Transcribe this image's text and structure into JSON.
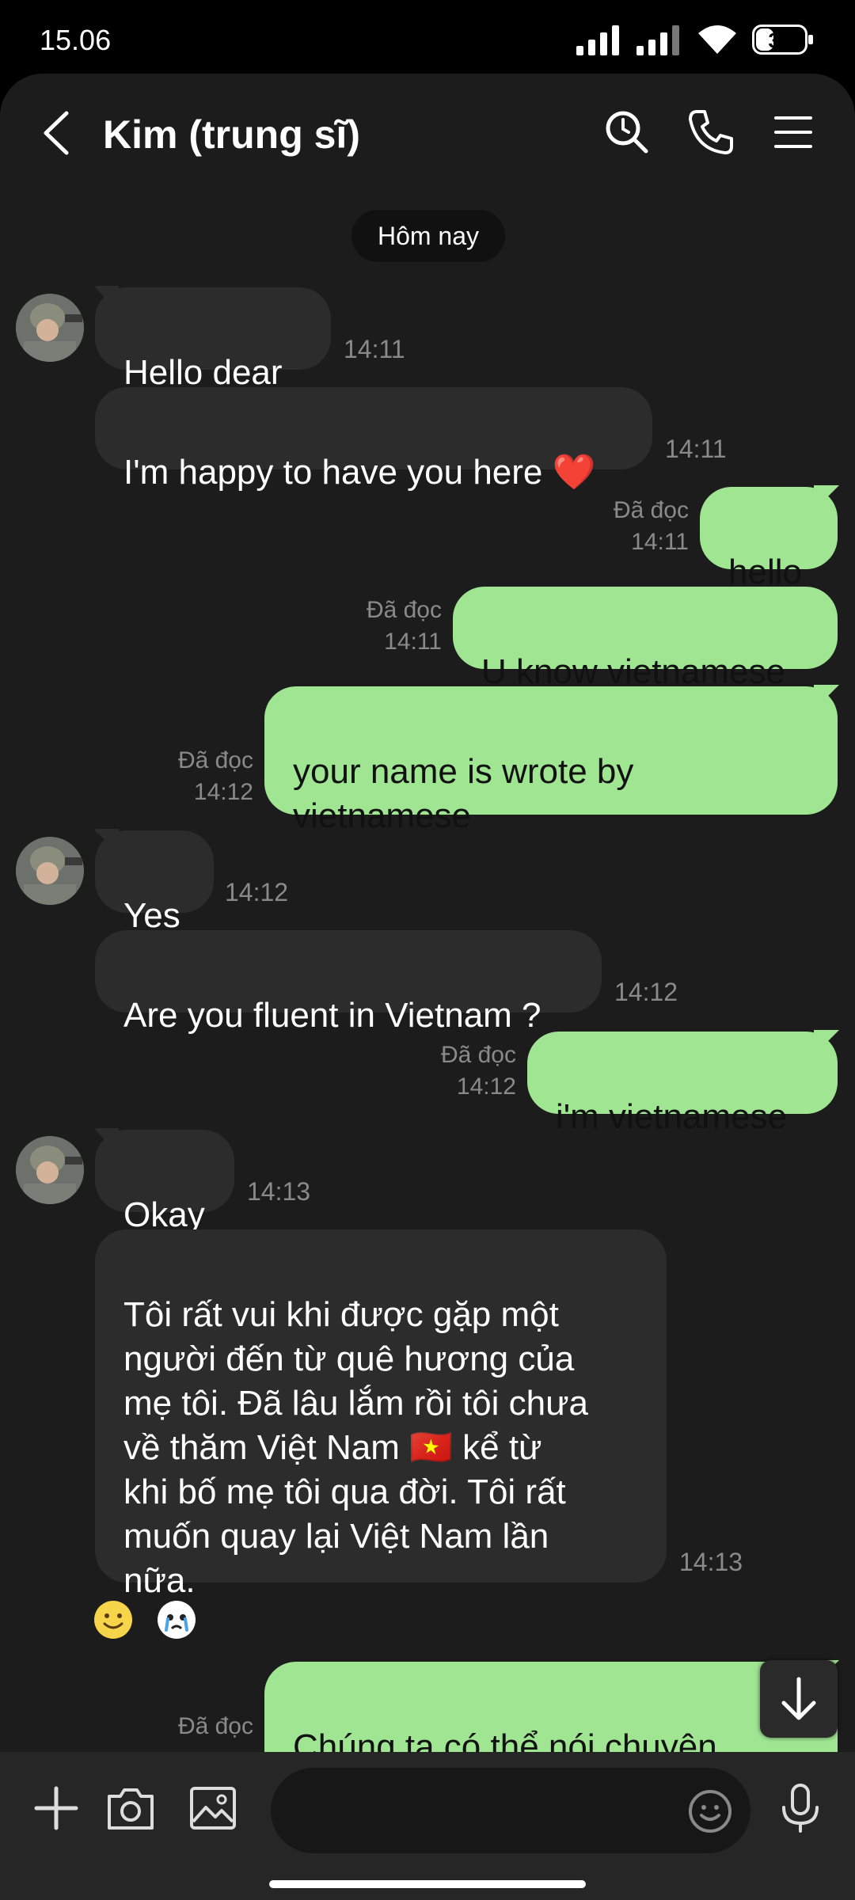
{
  "status_bar": {
    "time": "15.06",
    "battery_level": "35",
    "icons": [
      "signal-icon",
      "signal-icon",
      "wifi-icon",
      "battery-icon"
    ]
  },
  "header": {
    "title": "Kim (trung sĩ)",
    "icons": [
      "back-arrow-icon",
      "search-icon",
      "phone-icon",
      "menu-icon"
    ]
  },
  "chat": {
    "date_label": "Hôm nay",
    "messages": [
      {
        "from": "contact",
        "text": "Hello dear",
        "time": "14:11"
      },
      {
        "from": "contact",
        "text": "I'm happy to have you here ❤️",
        "time": "14:11"
      },
      {
        "from": "me",
        "text": "hello",
        "read_label": "Đã đọc",
        "time": "14:11"
      },
      {
        "from": "me",
        "text": "U know vietnamese",
        "read_label": "Đã đọc",
        "time": "14:11"
      },
      {
        "from": "me",
        "text": "your name is wrote by\nvietnamese",
        "read_label": "Đã đọc",
        "time": "14:12"
      },
      {
        "from": "contact",
        "text": "Yes",
        "time": "14:12"
      },
      {
        "from": "contact",
        "text": "Are you fluent in Vietnam ?",
        "time": "14:12"
      },
      {
        "from": "me",
        "text": "i'm vietnamese",
        "read_label": "Đã đọc",
        "time": "14:12"
      },
      {
        "from": "contact",
        "text": "Okay",
        "time": "14:13"
      },
      {
        "from": "contact",
        "text": "Tôi rất vui khi được gặp một\nngười đến từ quê hương của\nmẹ tôi. Đã lâu lắm rồi tôi chưa\nvề thăm Việt Nam 🇻🇳 kể từ\nkhi bố mẹ tôi qua đời. Tôi rất\nmuốn quay lại Việt Nam lần\nnữa.",
        "time": "14:13"
      },
      {
        "from": "me",
        "text": "Chúng ta có thể nói chuyện\nbằng tiếng việt chứ",
        "read_label": "Đã đọc"
      }
    ],
    "reactions": [
      "smile-emoji-icon",
      "crying-sticker-icon"
    ]
  },
  "input_bar": {
    "icons": [
      "plus-icon",
      "camera-icon",
      "gallery-icon",
      "emoji-icon",
      "microphone-icon"
    ]
  },
  "colors": {
    "incoming_bubble": "#2c2c2c",
    "outgoing_bubble": "#9fe592",
    "background": "#1c1c1c"
  }
}
